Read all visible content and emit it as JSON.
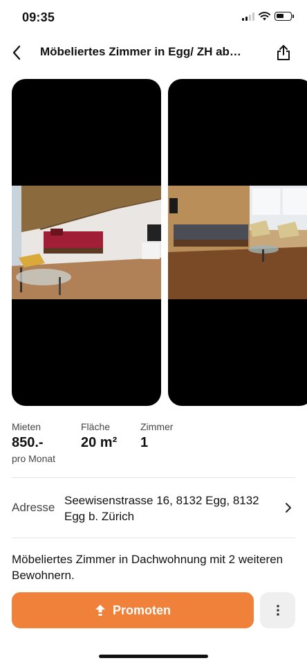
{
  "status": {
    "time": "09:35"
  },
  "nav": {
    "title": "Möbeliertes Zimmer in Egg/ ZH ab…",
    "back_icon": "chevron-left-icon",
    "share_icon": "share-icon"
  },
  "gallery": {
    "photos": [
      "room-photo-1",
      "room-photo-2"
    ]
  },
  "facts": {
    "rent_label": "Mieten",
    "rent_value": "850.-",
    "rent_sub": "pro Monat",
    "area_label": "Fläche",
    "area_value": "20 m²",
    "rooms_label": "Zimmer",
    "rooms_value": "1"
  },
  "address": {
    "label": "Adresse",
    "value": "Seewisenstrasse 16, 8132 Egg, 8132 Egg b. Zürich"
  },
  "description": "Möbeliertes Zimmer in Dachwohnung mit 2 weiteren Bewohnern.",
  "actions": {
    "promote_label": "Promoten",
    "promote_icon": "boost-arrow-icon",
    "more_icon": "more-vertical-icon"
  },
  "colors": {
    "accent": "#f0813a",
    "secondary_button": "#efefef"
  }
}
